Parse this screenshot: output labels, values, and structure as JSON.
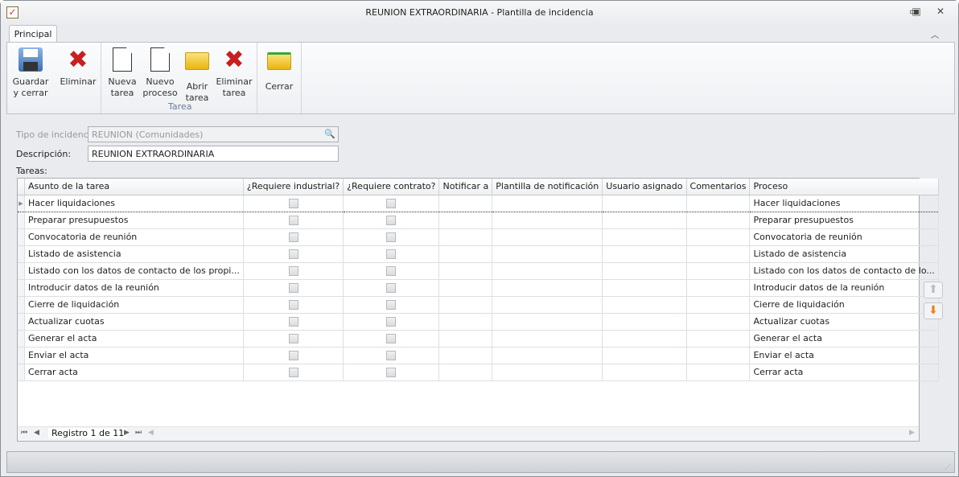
{
  "window": {
    "title": "REUNION EXTRAORDINARIA - Plantilla de incidencia"
  },
  "ribbon": {
    "tab": "Principal",
    "buttons": {
      "guardar": "Guardar y cerrar",
      "eliminar": "Eliminar",
      "nueva_tarea": "Nueva tarea",
      "nuevo_proceso": "Nuevo proceso",
      "abrir_tarea": "Abrir tarea",
      "eliminar_tarea": "Eliminar tarea",
      "cerrar": "Cerrar"
    },
    "group_tarea": "Tarea"
  },
  "form": {
    "tipo_label": "Tipo de incidencia",
    "tipo_value": "REUNION (Comunidades)",
    "descripcion_label": "Descripción:",
    "descripcion_value": "REUNION EXTRAORDINARIA",
    "tareas_label": "Tareas:"
  },
  "grid": {
    "columns": [
      "Asunto de la tarea",
      "¿Requiere industrial?",
      "¿Requiere contrato?",
      "Notificar a",
      "Plantilla de notificación",
      "Usuario asignado",
      "Comentarios",
      "Proceso"
    ],
    "rows": [
      {
        "asunto": "Hacer liquidaciones",
        "proceso": "Hacer liquidaciones"
      },
      {
        "asunto": "Preparar presupuestos",
        "proceso": "Preparar presupuestos"
      },
      {
        "asunto": "Convocatoria de reunión",
        "proceso": "Convocatoria de reunión"
      },
      {
        "asunto": "Listado de asistencia",
        "proceso": "Listado de asistencia"
      },
      {
        "asunto": "Listado con los datos de contacto de los propi...",
        "proceso": "Listado con los datos de contacto de lo..."
      },
      {
        "asunto": "Introducir datos de la reunión",
        "proceso": "Introducir datos de la reunión"
      },
      {
        "asunto": "Cierre de liquidación",
        "proceso": "Cierre de liquidación"
      },
      {
        "asunto": "Actualizar cuotas",
        "proceso": "Actualizar cuotas"
      },
      {
        "asunto": "Generar el acta",
        "proceso": "Generar el acta"
      },
      {
        "asunto": "Enviar el acta",
        "proceso": "Enviar el acta"
      },
      {
        "asunto": "Cerrar acta",
        "proceso": "Cerrar acta"
      }
    ],
    "navigator": "Registro 1 de 11"
  }
}
